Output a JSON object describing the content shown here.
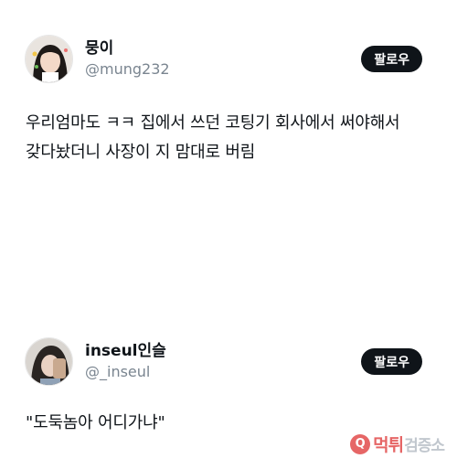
{
  "posts": [
    {
      "display_name": "뭉이",
      "handle": "@mung232",
      "follow_label": "팔로우",
      "text_lines": [
        "우리엄마도 ㅋㅋ 집에서 쓰던 코팅기 회사에서 써야해서",
        "갖다놨더니 사장이 지 맘대로 버림"
      ]
    },
    {
      "display_name": "inseul인슬",
      "handle": "@_inseul",
      "follow_label": "팔로우",
      "text_lines": [
        "\"도둑놈아 어디가냐\""
      ]
    }
  ],
  "watermark": {
    "icon": "Q",
    "brand": "먹튀",
    "sub": "검증소"
  },
  "colors": {
    "button_bg": "#0f1419",
    "handle": "#7a8590",
    "watermark": "#e24c4c"
  }
}
